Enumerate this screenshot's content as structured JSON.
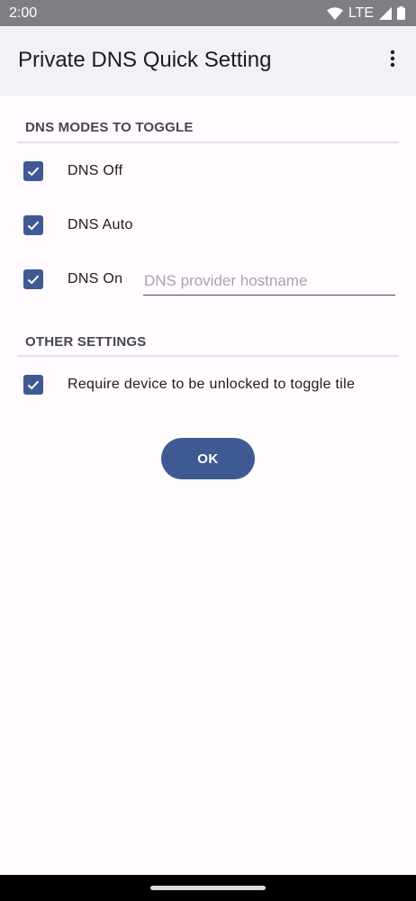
{
  "status_bar": {
    "time": "2:00",
    "network": "LTE",
    "icons": [
      "wifi-icon",
      "cell-signal-icon",
      "battery-icon"
    ]
  },
  "app_bar": {
    "title": "Private DNS Quick Setting",
    "menu_icon": "more-vert-icon"
  },
  "dns_modes": {
    "header": "DNS MODES TO TOGGLE",
    "items": [
      {
        "label": "DNS Off",
        "checked": true
      },
      {
        "label": "DNS Auto",
        "checked": true
      },
      {
        "label": "DNS On",
        "checked": true
      }
    ],
    "hostname": {
      "value": "",
      "placeholder": "DNS provider hostname"
    }
  },
  "other_settings": {
    "header": "OTHER SETTINGS",
    "items": [
      {
        "label": "Require device to be unlocked to toggle tile",
        "checked": true
      }
    ]
  },
  "ok_button": {
    "label": "OK"
  },
  "colors": {
    "accent": "#3f5a93",
    "background": "#fffbff",
    "app_bar": "#f3f1f6",
    "status_bar": "#7f7f83"
  }
}
